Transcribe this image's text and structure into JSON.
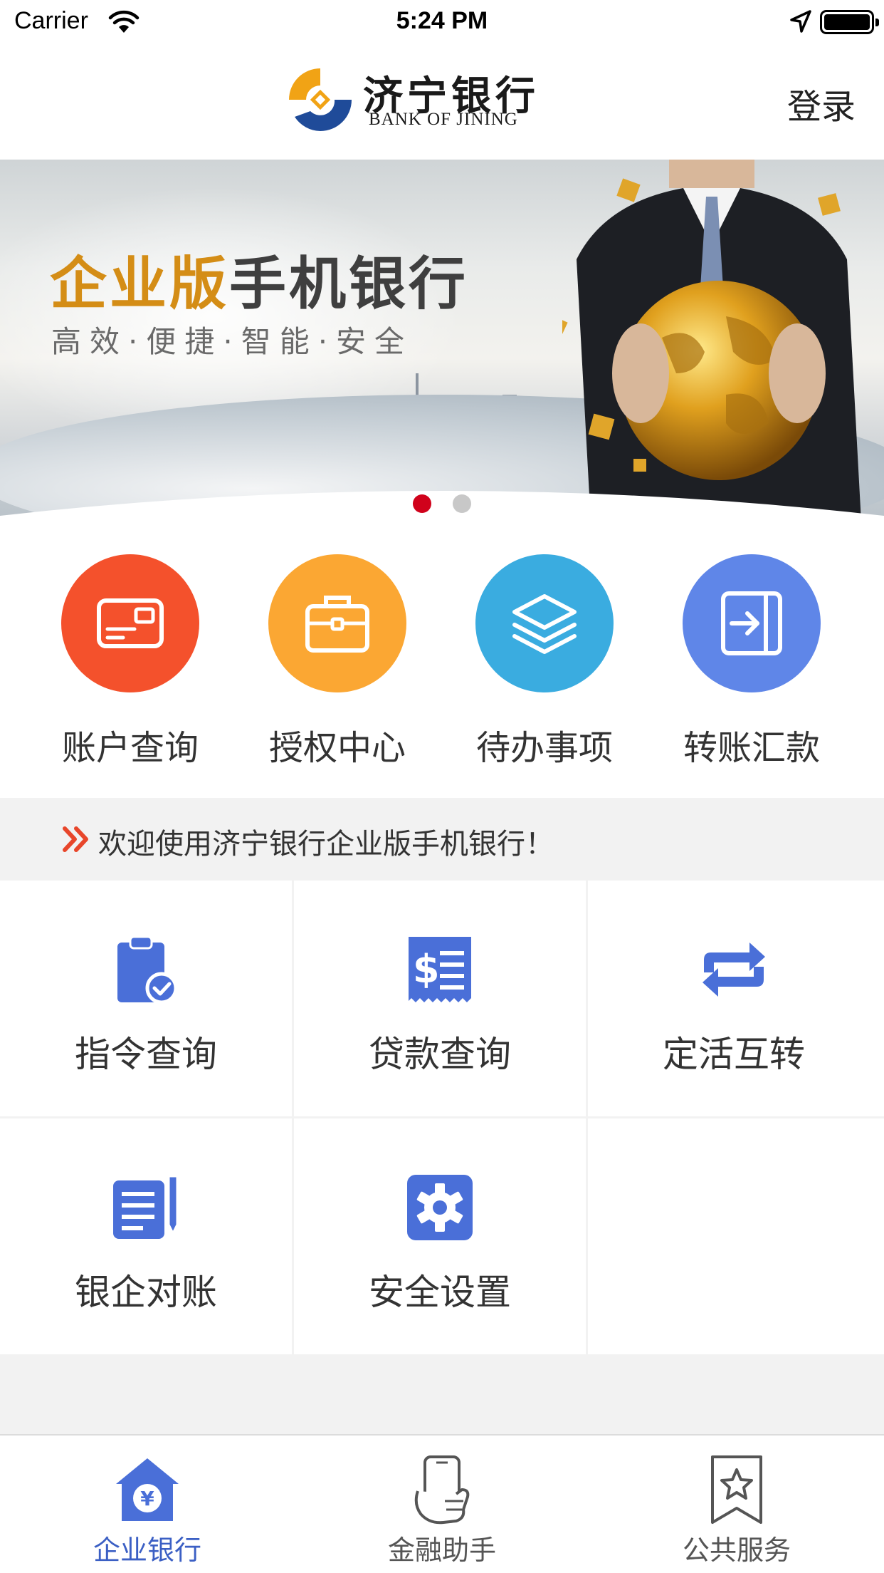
{
  "status_bar": {
    "carrier": "Carrier",
    "time": "5:24 PM"
  },
  "header": {
    "logo_cn": "济宁银行",
    "logo_en": "BANK OF JINING",
    "login_label": "登录"
  },
  "banner": {
    "title_highlight": "企业版",
    "title_rest": "手机银行",
    "subtitle": "高效·便捷·智能·安全",
    "slide_count": 2,
    "active_slide": 1
  },
  "quick_actions": [
    {
      "label": "账户查询",
      "icon": "card-icon",
      "color": "#f4512c"
    },
    {
      "label": "授权中心",
      "icon": "briefcase-icon",
      "color": "#fba733"
    },
    {
      "label": "待办事项",
      "icon": "layers-icon",
      "color": "#3aace0"
    },
    {
      "label": "转账汇款",
      "icon": "transfer-in-icon",
      "color": "#5f86e8"
    }
  ],
  "notice": {
    "text": "欢迎使用济宁银行企业版手机银行！"
  },
  "functions": [
    {
      "label": "指令查询",
      "icon": "clipboard-check-icon"
    },
    {
      "label": "贷款查询",
      "icon": "dollar-receipt-icon"
    },
    {
      "label": "定活互转",
      "icon": "swap-arrows-icon"
    },
    {
      "label": "银企对账",
      "icon": "document-pen-icon"
    },
    {
      "label": "安全设置",
      "icon": "gear-icon"
    }
  ],
  "tabs": [
    {
      "label": "企业银行",
      "icon": "home-yuan-icon",
      "active": true
    },
    {
      "label": "金融助手",
      "icon": "phone-hand-icon",
      "active": false
    },
    {
      "label": "公共服务",
      "icon": "bookmark-star-icon",
      "active": false
    }
  ],
  "colors": {
    "accent_blue": "#4a6fd8",
    "brand_gold": "#d48d16",
    "active_dot": "#d0021b",
    "notice_arrow": "#e8462b"
  }
}
